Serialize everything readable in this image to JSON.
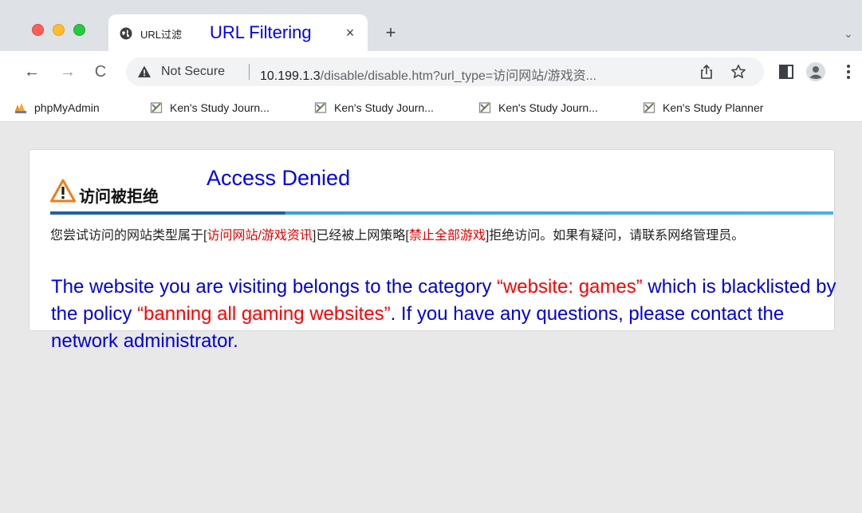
{
  "tab": {
    "title_zh": "URL过滤",
    "title_en": "URL Filtering",
    "close": "×"
  },
  "toolbar": {
    "new_tab": "+",
    "tab_search": "⌄",
    "back": "←",
    "forward": "→",
    "reload": "C"
  },
  "omnibox": {
    "security_label": "Not Secure",
    "host": "10.199.1.3",
    "path": "/disable/disable.htm?url_type=访问网站/游戏资..."
  },
  "bookmarks": [
    {
      "label": "phpMyAdmin",
      "icon": "phpmyadmin-icon"
    },
    {
      "label": "Ken's Study Journ...",
      "icon": "notion-icon"
    },
    {
      "label": "Ken's Study Journ...",
      "icon": "notion-icon"
    },
    {
      "label": "Ken's Study Journ...",
      "icon": "notion-icon"
    },
    {
      "label": "Ken's Study Planner",
      "icon": "notion-icon"
    }
  ],
  "page": {
    "heading_zh": "访问被拒绝",
    "heading_en": "Access Denied",
    "desc_zh_1": "您尝试访问的网站类型属于[",
    "desc_zh_category": "访问网站/游戏资讯",
    "desc_zh_2": "]已经被上网策略[",
    "desc_zh_policy": "禁止全部游戏",
    "desc_zh_3": "]拒绝访问。如果有疑问，请联系网络管理员。",
    "en_1": "The website you are visiting belongs to the category ",
    "en_category": "“website: games”",
    "en_2": " which is blacklisted by the policy ",
    "en_policy": "“banning all gaming websites”",
    "en_3": ". If you have any questions, please contact the network administrator."
  },
  "colors": {
    "accent_blue": "#0000ee",
    "highlight_red": "#e60000",
    "warning_orange": "#f07d1a"
  }
}
